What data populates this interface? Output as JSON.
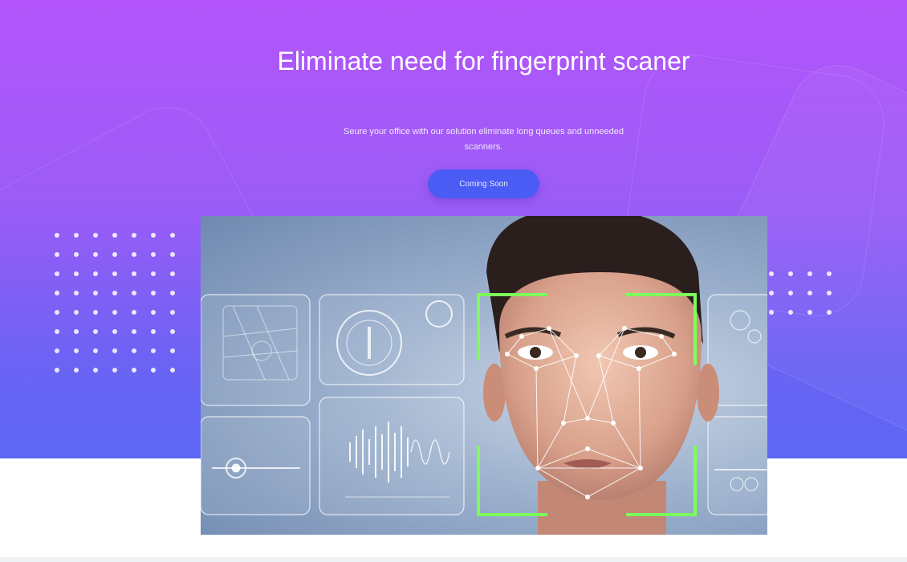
{
  "hero": {
    "title": "Eliminate need for fingerprint scaner",
    "subtitle": "Seure your office with our solution eliminate long queues and unneeded scanners.",
    "cta_label": "Coming Soon"
  },
  "colors": {
    "gradient_top": "#b355fb",
    "gradient_bottom": "#5d66f4",
    "button": "#4b5cf5",
    "face_frame": "#7cff5a"
  },
  "image": {
    "subject": "face-recognition-photo"
  }
}
